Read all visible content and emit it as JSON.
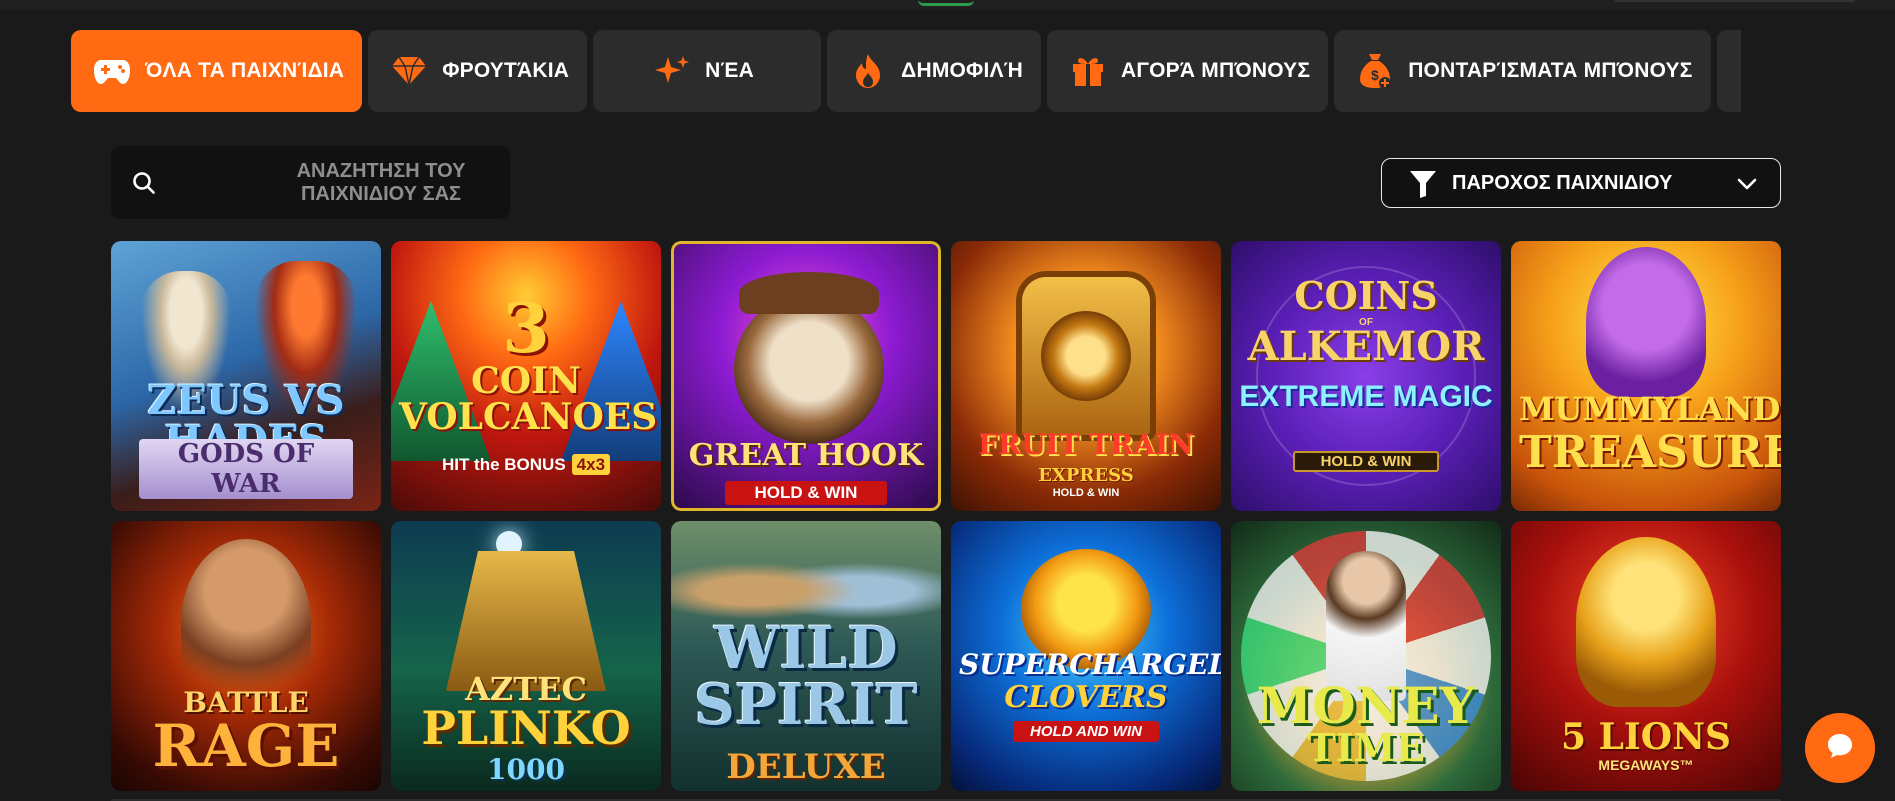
{
  "colors": {
    "accent": "#ff6a13",
    "background": "#1a1a1a",
    "tab_bg": "#2c2c2c",
    "search_bg": "#111111"
  },
  "tabs": [
    {
      "label": "ΌΛΑ ΤΑ ΠΑΙΧΝΊΔΙΑ",
      "icon": "gamepad-icon",
      "active": true
    },
    {
      "label": "ΦΡΟΥΤΆΚΙΑ",
      "icon": "diamond-icon",
      "active": false
    },
    {
      "label": "ΝΈΑ",
      "icon": "sparkle-icon",
      "active": false
    },
    {
      "label": "ΔΗΜΟΦΙΛΉ",
      "icon": "flame-icon",
      "active": false
    },
    {
      "label": "ΑΓΟΡΆ ΜΠΌΝΟΥΣ",
      "icon": "gift-icon",
      "active": false
    },
    {
      "label": "ΠΟΝΤΑΡΊΣΜΑΤΑ ΜΠΌΝΟΥΣ",
      "icon": "money-bag-icon",
      "active": false
    }
  ],
  "search": {
    "placeholder_line1": "ΑΝΑΖΗΤΗΣΗ ΤΟΥ",
    "placeholder_line2": "ΠΑΙΧΝΙΔΙΟΥ ΣΑΣ",
    "icon": "search-icon"
  },
  "provider_filter": {
    "label": "ΠΑΡΟΧΟΣ ΠΑΙΧΝΙΔΙΟΥ",
    "icon": "filter-icon",
    "chevron": "chevron-down-icon"
  },
  "games": [
    {
      "id": "zeus",
      "title": "ZEUS vs HADES",
      "subtitle": "GODS OF WAR"
    },
    {
      "id": "volcanoes",
      "number": "3",
      "title": "COIN VOLCANOES",
      "subtitle": "HIT the BONUS",
      "badge": "4x3"
    },
    {
      "id": "hook",
      "title": "GREAT HOOK",
      "subtitle": "HOLD & WIN"
    },
    {
      "id": "train",
      "title": "FRUIT TRAIN",
      "subtitle": "EXPRESS",
      "tag": "HOLD & WIN"
    },
    {
      "id": "alkemor",
      "title": "COINS",
      "of": "OF",
      "title2": "ALKEMOR",
      "subtitle": "EXTREME MAGIC",
      "tag": "HOLD & WIN"
    },
    {
      "id": "mummy",
      "title": "MUMMYLAND",
      "title2": "TREASURES"
    },
    {
      "id": "battle",
      "title": "BATTLE",
      "title2": "RAGE"
    },
    {
      "id": "plinko",
      "title": "AZTEC",
      "title2": "PLINKO",
      "number": "1000"
    },
    {
      "id": "spirit",
      "title": "WILD",
      "title2": "SPIRIT",
      "subtitle": "DELUXE"
    },
    {
      "id": "clovers",
      "title": "SUPERCHARGED",
      "title2": "CLOVERS",
      "subtitle": "HOLD AND WIN"
    },
    {
      "id": "money",
      "title": "MONEY",
      "title2": "TIME"
    },
    {
      "id": "lions",
      "title": "5 LIONS",
      "subtitle": "MEGAWAYS™"
    }
  ],
  "chat": {
    "icon": "chat-bubble-icon"
  }
}
